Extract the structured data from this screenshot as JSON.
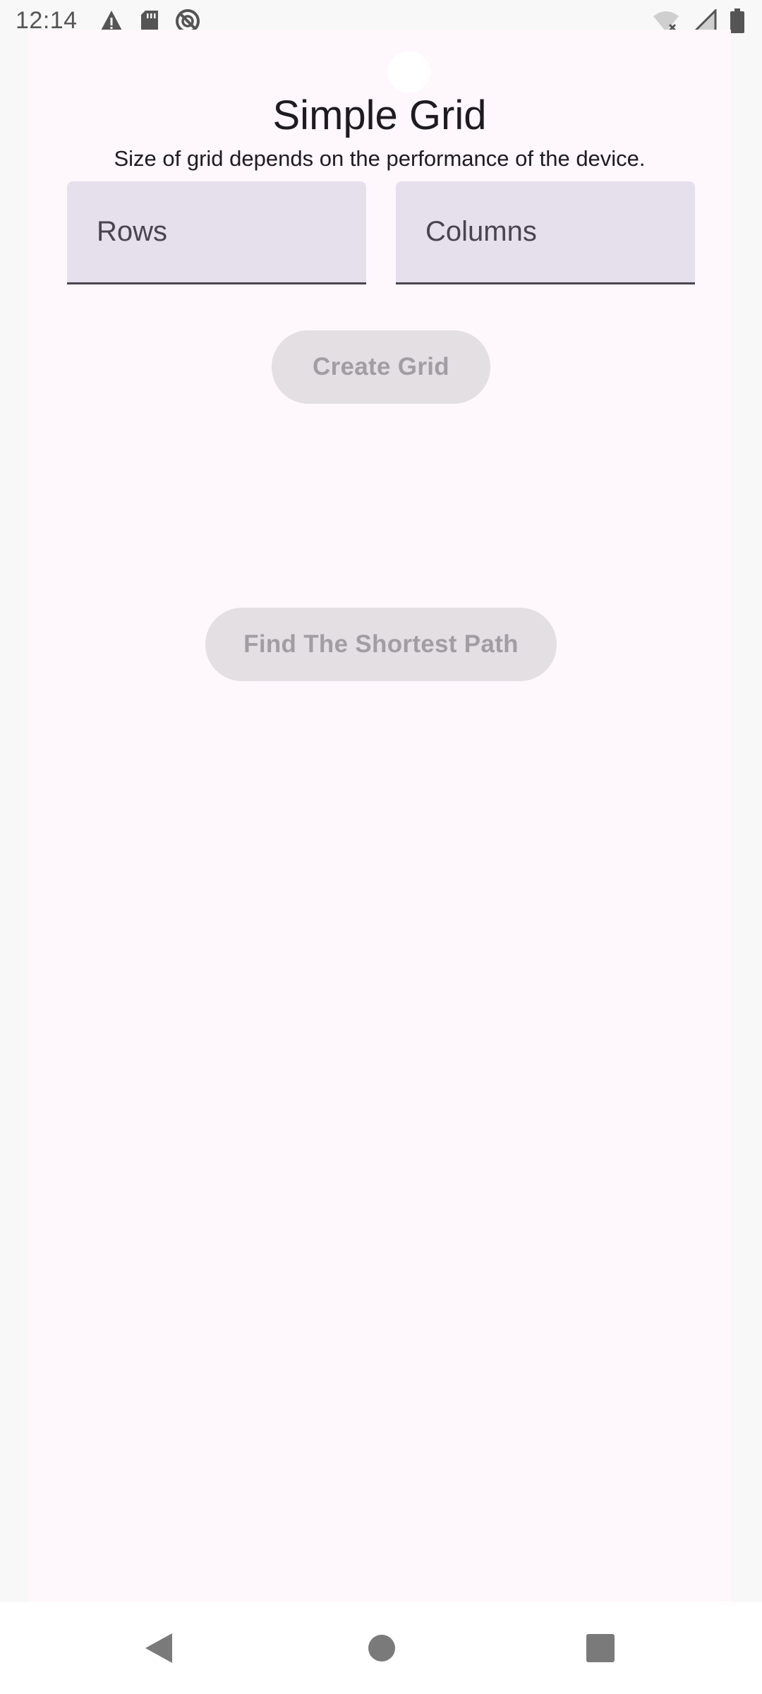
{
  "status_bar": {
    "time": "12:14",
    "left_icons": [
      "warning-icon",
      "sd-card-icon",
      "do-not-disturb-icon"
    ],
    "right_icons": [
      "wifi-off-icon",
      "signal-icon",
      "battery-icon"
    ]
  },
  "app": {
    "title": "Simple Grid",
    "subtitle": "Size of grid depends on the performance of the device.",
    "rows_field": {
      "placeholder": "Rows",
      "value": ""
    },
    "columns_field": {
      "placeholder": "Columns",
      "value": ""
    },
    "create_button_label": "Create Grid",
    "path_button_label": "Find The Shortest Path"
  },
  "nav_bar": {
    "icons": [
      "back-icon",
      "home-icon",
      "recents-icon"
    ]
  },
  "colors": {
    "surface": "#fef7fc",
    "field_bg": "#e6e0ec",
    "button_disabled_bg": "#e3dfe2",
    "button_disabled_text": "#a19da3"
  }
}
